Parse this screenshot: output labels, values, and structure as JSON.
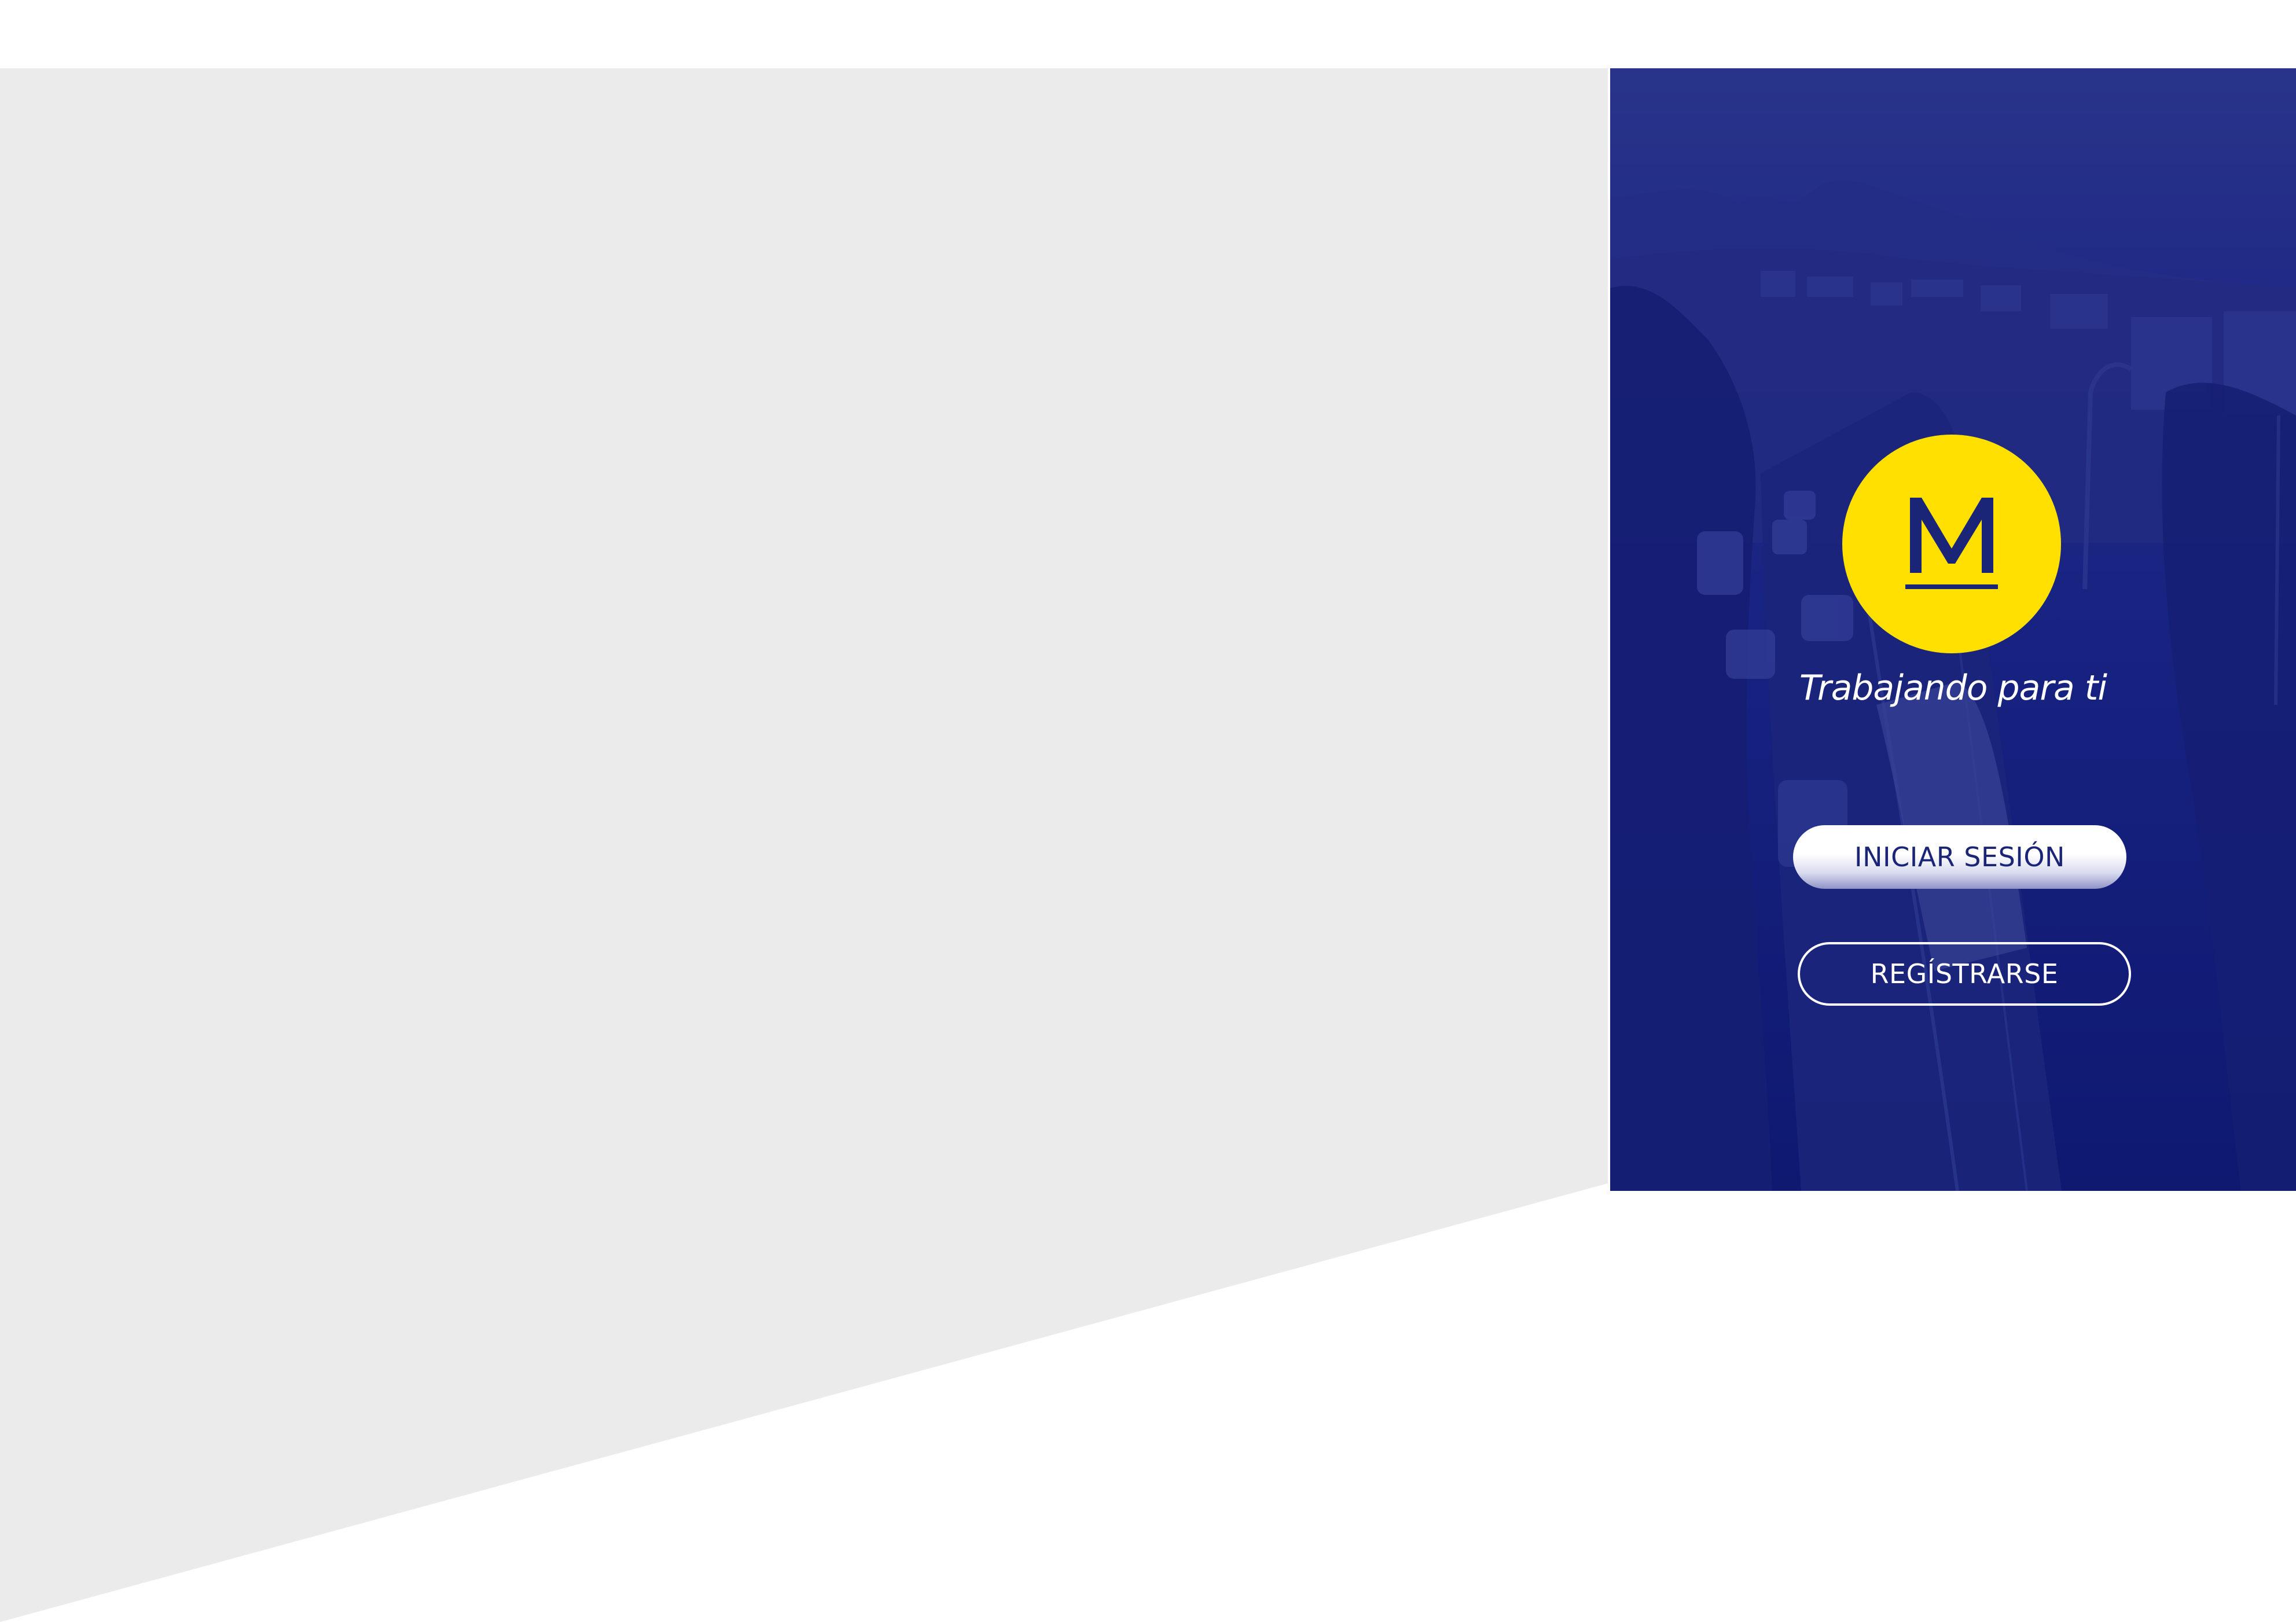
{
  "app": {
    "tagline": "Trabajando para ti",
    "logo_letter": "M",
    "logo_name": "metro-logo"
  },
  "actions": {
    "login_label": "INICIAR SESIÓN",
    "register_label": "REGÍSTRARSE"
  },
  "colors": {
    "overlay_blue": "#172280",
    "logo_yellow": "#ffe000",
    "logo_letter": "#1b2577",
    "background_gray": "#ebebeb",
    "white": "#ffffff"
  },
  "icons": {
    "logo": "letter-m-underlined"
  }
}
